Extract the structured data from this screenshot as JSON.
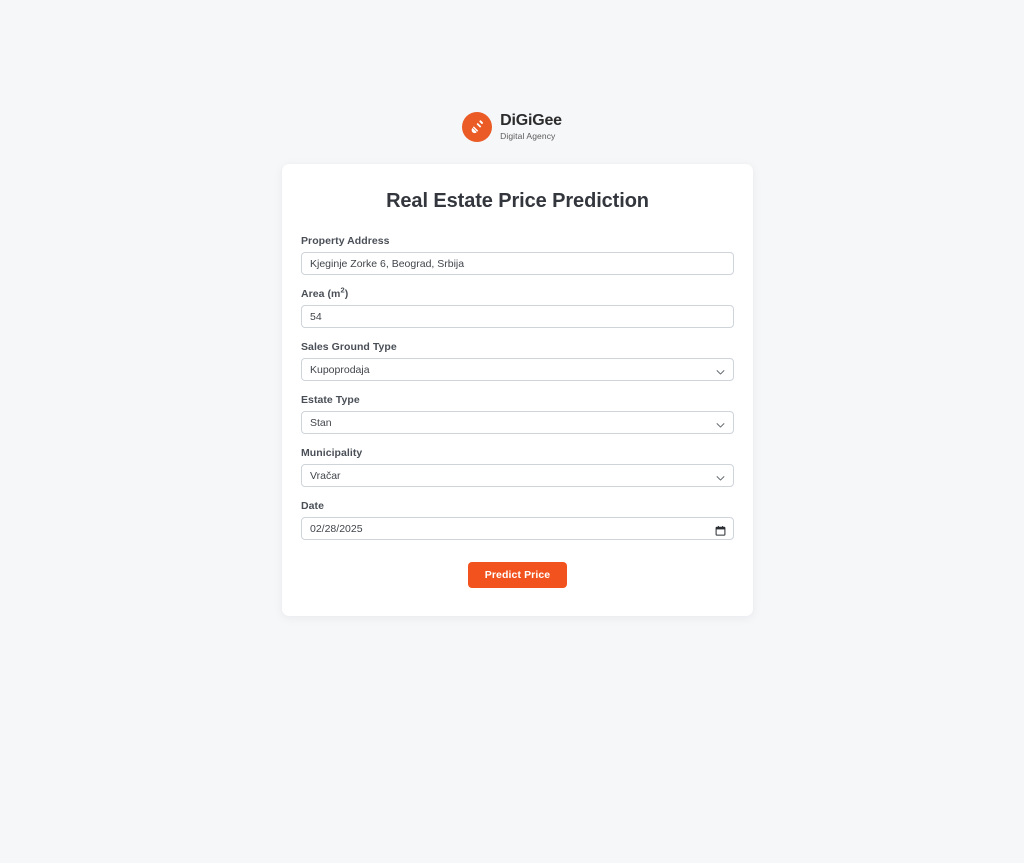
{
  "colors": {
    "page_bg": "#f6f7f9",
    "card_bg": "#ffffff",
    "brand_orange": "#ea5b26",
    "accent_button": "#f1521e",
    "input_border": "#ced4da",
    "label_text": "#4a4f57",
    "title_text": "#33373d"
  },
  "brand": {
    "name": "DiGiGee",
    "tagline": "Digital Agency",
    "logo_icon": "shovel-icon"
  },
  "card": {
    "title": "Real Estate Price Prediction"
  },
  "form": {
    "fields": [
      {
        "key": "property_address",
        "label": "Property Address",
        "type": "text",
        "value": "Kjeginje Zorke 6, Beograd, Srbija",
        "placeholder": "Property Address"
      },
      {
        "key": "area",
        "label": "Area (m",
        "label_sup": "2",
        "label_suffix": ")",
        "label_full": "Area (m²)",
        "type": "number",
        "value": "54",
        "placeholder": "Area"
      },
      {
        "key": "sales_ground_type",
        "label": "Sales Ground Type",
        "type": "select",
        "value": "Kupoprodaja",
        "icon": "chevron-down-icon",
        "options": [
          "Kupoprodaja"
        ]
      },
      {
        "key": "estate_type",
        "label": "Estate Type",
        "type": "select",
        "value": "Stan",
        "icon": "chevron-down-icon",
        "options": [
          "Stan"
        ]
      },
      {
        "key": "municipality",
        "label": "Municipality",
        "type": "select",
        "value": "Vračar",
        "icon": "chevron-down-icon",
        "options": [
          "Vračar"
        ]
      },
      {
        "key": "date",
        "label": "Date",
        "type": "date",
        "value": "02/28/2025",
        "icon": "calendar-icon"
      }
    ],
    "submit_label": "Predict Price"
  }
}
